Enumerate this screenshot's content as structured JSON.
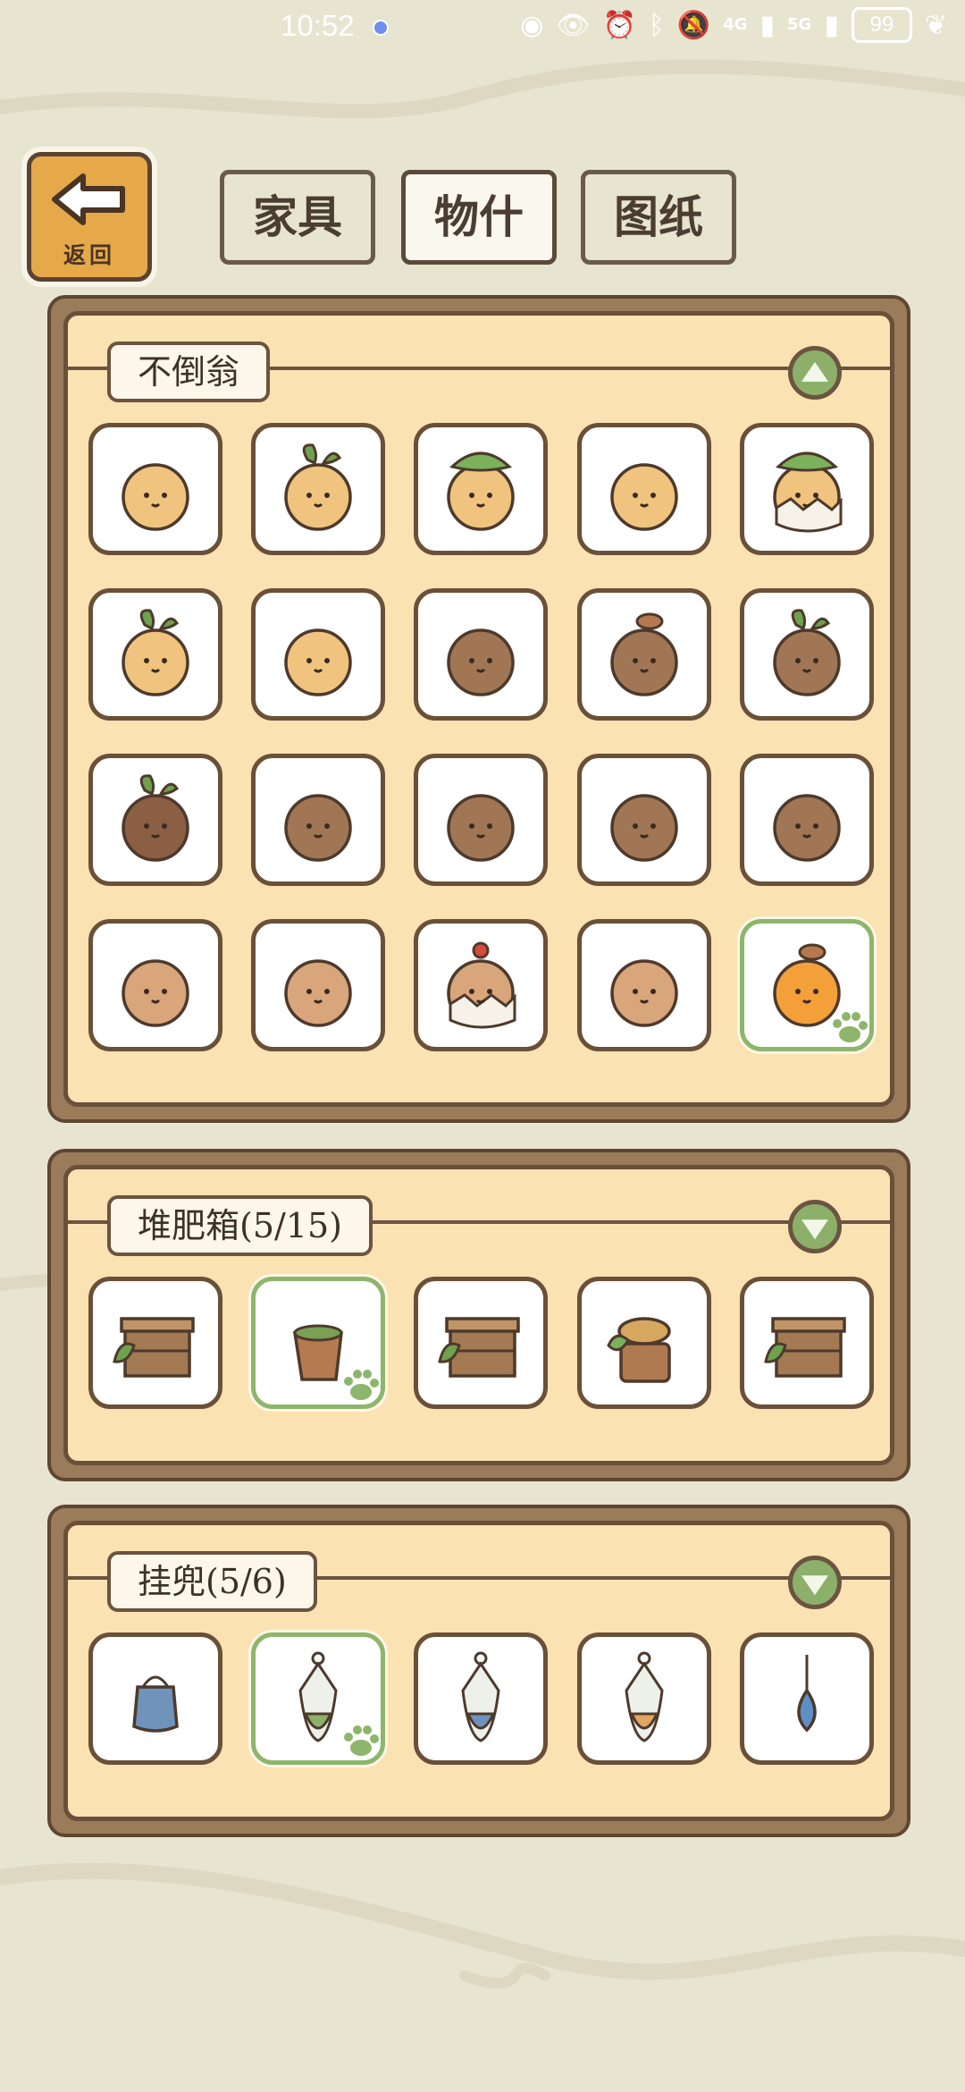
{
  "status_bar": {
    "time": "10:52",
    "network_4g": "4G",
    "network_5g": "5G",
    "battery": "99"
  },
  "back_button": {
    "label": "返回"
  },
  "tabs": [
    {
      "label": "家具",
      "active": false
    },
    {
      "label": "物什",
      "active": true
    },
    {
      "label": "图纸",
      "active": false
    }
  ],
  "sections": [
    {
      "title": "不倒翁",
      "expanded": true,
      "selected_index": 19,
      "items": [
        {
          "icon": "yellow-tumbler-squint"
        },
        {
          "icon": "yellow-tumbler-bow"
        },
        {
          "icon": "leaf-hat-tumbler"
        },
        {
          "icon": "yellow-tumbler-glasses"
        },
        {
          "icon": "leaf-hat-chick-tumbler"
        },
        {
          "icon": "sprout-tumbler"
        },
        {
          "icon": "yellow-tumbler-smile"
        },
        {
          "icon": "brown-monkey-tumbler"
        },
        {
          "icon": "mushroom-owl-tumbler"
        },
        {
          "icon": "brown-sprout-tumbler"
        },
        {
          "icon": "dark-sprout-tumbler"
        },
        {
          "icon": "brown-tumbler-eyes"
        },
        {
          "icon": "brown-tumbler-blush"
        },
        {
          "icon": "brown-tumbler-plain"
        },
        {
          "icon": "brown-tumbler-grumpy"
        },
        {
          "icon": "tan-tumbler"
        },
        {
          "icon": "leaf-tumbler-hearts"
        },
        {
          "icon": "cherry-chick-tumbler"
        },
        {
          "icon": "sleepy-tumbler"
        },
        {
          "icon": "orange-mushroom-tumbler"
        }
      ]
    },
    {
      "title": "堆肥箱(5/15)",
      "expanded": false,
      "selected_index": 1,
      "items": [
        {
          "icon": "wooden-compost-crate"
        },
        {
          "icon": "wooden-bucket"
        },
        {
          "icon": "stacked-compost-crate"
        },
        {
          "icon": "mushroom-barrel"
        },
        {
          "icon": "open-lid-compost-box"
        }
      ]
    },
    {
      "title": "挂兜(5/6)",
      "expanded": false,
      "selected_index": 1,
      "items": [
        {
          "icon": "blue-hanging-pouch"
        },
        {
          "icon": "green-net-bag"
        },
        {
          "icon": "blue-net-bag"
        },
        {
          "icon": "orange-net-bag"
        },
        {
          "icon": "water-drop-charm"
        }
      ]
    }
  ],
  "colors": {
    "background": "#e7e4d0",
    "panel_wood": "#9a7b5a",
    "panel_inner": "#fbe2b2",
    "selected_border": "#8db66c",
    "back_button": "#e6a94a"
  }
}
